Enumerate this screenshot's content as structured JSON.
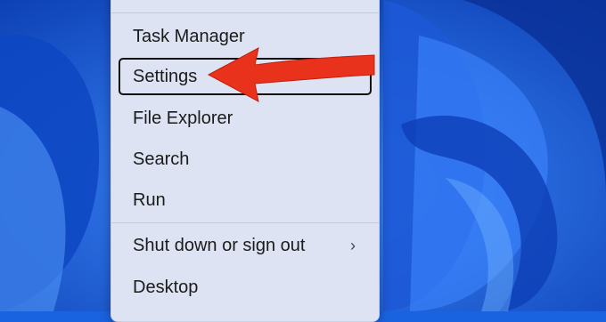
{
  "menu": {
    "items": [
      {
        "label": "Task Manager"
      },
      {
        "label": "Settings",
        "selected": true
      },
      {
        "label": "File Explorer"
      },
      {
        "label": "Search"
      },
      {
        "label": "Run"
      },
      {
        "label": "Shut down or sign out",
        "has_submenu": true
      },
      {
        "label": "Desktop"
      }
    ]
  },
  "annotation": {
    "arrow_color": "#e8321c"
  },
  "colors": {
    "wallpaper": "#1a63e0",
    "menu_bg": "#dde3f2"
  }
}
